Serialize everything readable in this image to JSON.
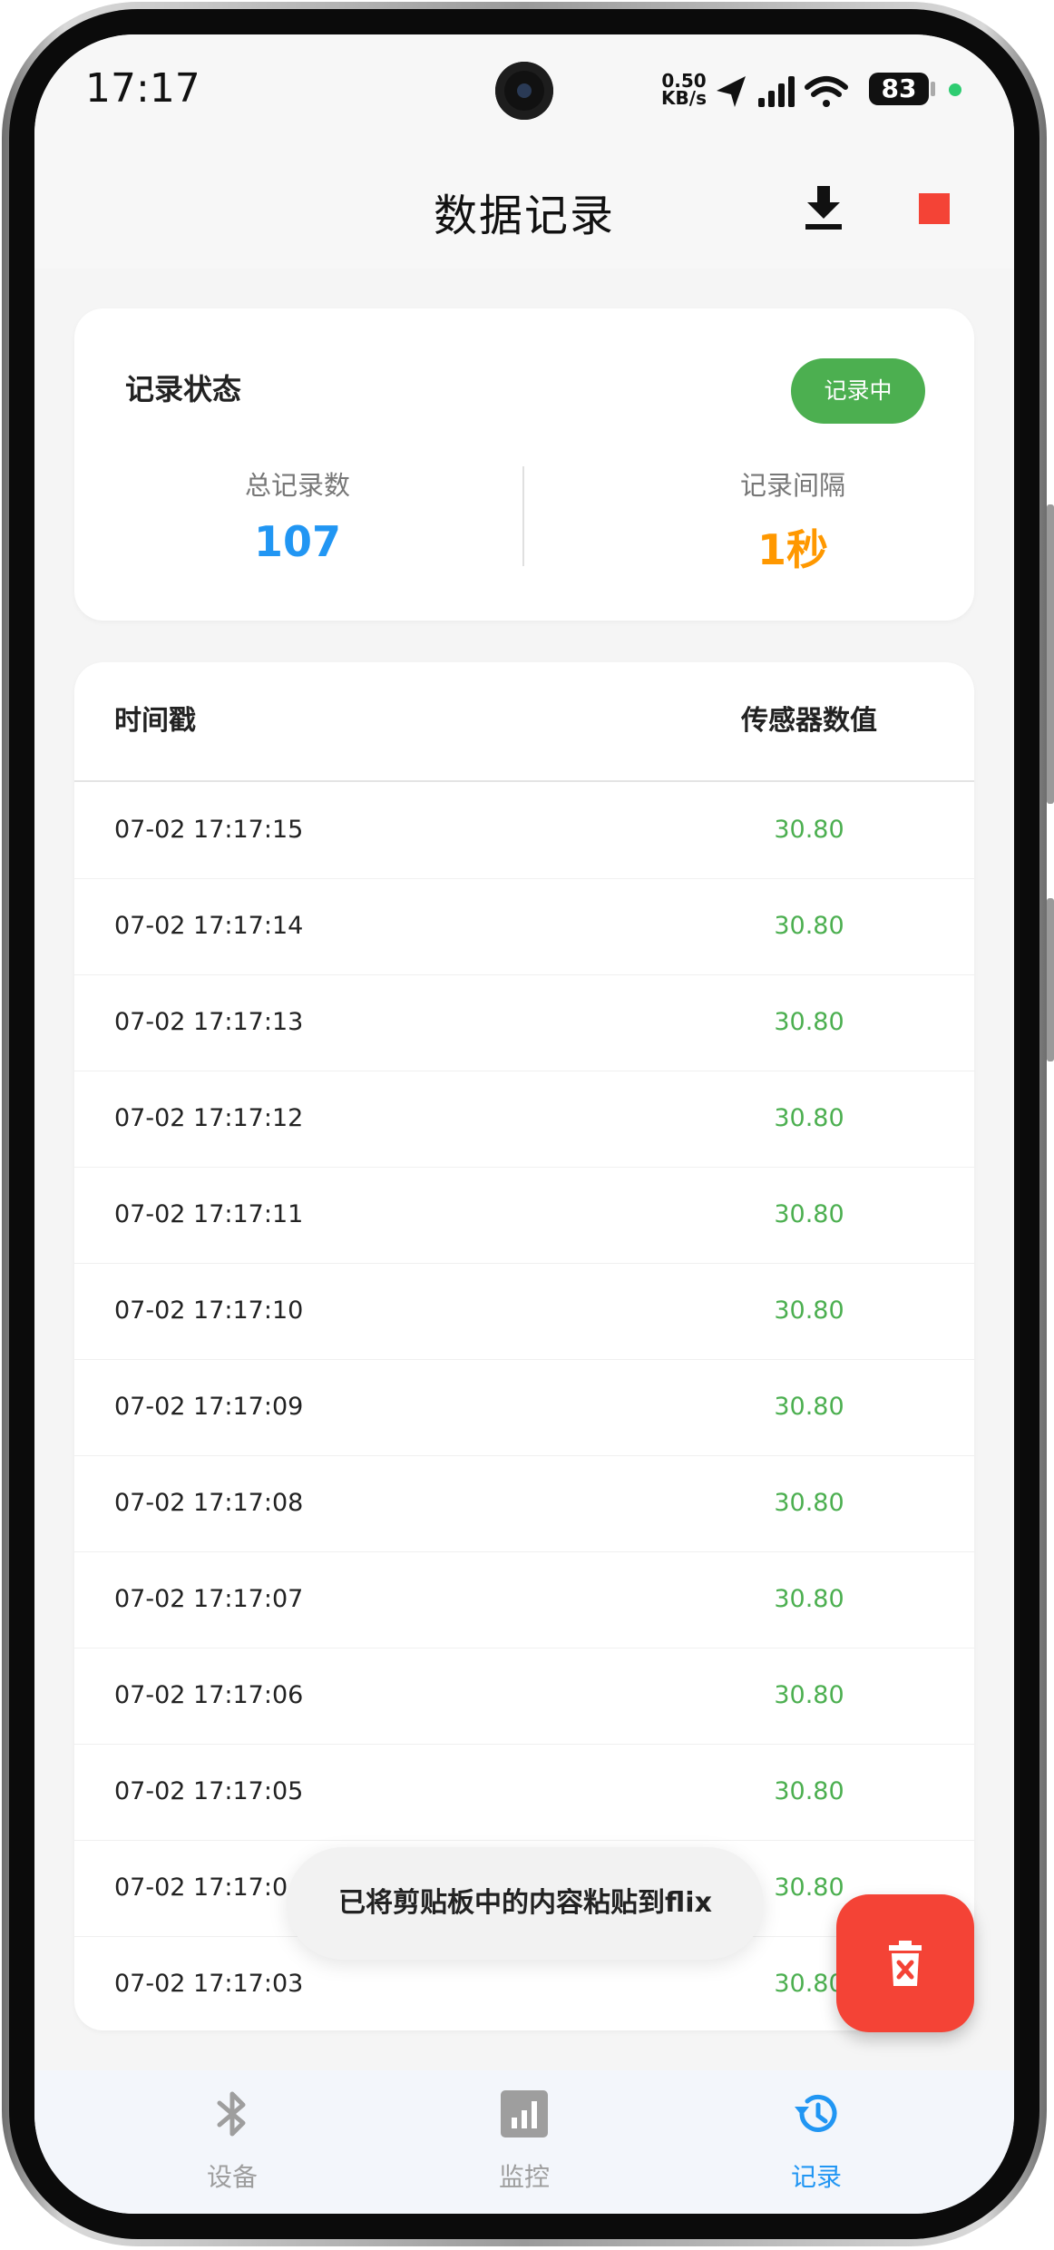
{
  "status_bar": {
    "time": "17:17",
    "net_speed_value": "0.50",
    "net_speed_unit": "KB/s",
    "battery": "83"
  },
  "header": {
    "title": "数据记录",
    "download_icon": "download-icon",
    "stop_icon": "stop-icon"
  },
  "status_card": {
    "title": "记录状态",
    "badge": "记录中",
    "total_label": "总记录数",
    "total_value": "107",
    "interval_label": "记录间隔",
    "interval_value": "1秒",
    "colors": {
      "total": "#2196f3",
      "interval": "#ff9800",
      "badge": "#4caf50"
    }
  },
  "table": {
    "col_time": "时间戳",
    "col_value": "传感器数值",
    "rows": [
      {
        "time": "07-02 17:17:15",
        "value": "30.80"
      },
      {
        "time": "07-02 17:17:14",
        "value": "30.80"
      },
      {
        "time": "07-02 17:17:13",
        "value": "30.80"
      },
      {
        "time": "07-02 17:17:12",
        "value": "30.80"
      },
      {
        "time": "07-02 17:17:11",
        "value": "30.80"
      },
      {
        "time": "07-02 17:17:10",
        "value": "30.80"
      },
      {
        "time": "07-02 17:17:09",
        "value": "30.80"
      },
      {
        "time": "07-02 17:17:08",
        "value": "30.80"
      },
      {
        "time": "07-02 17:17:07",
        "value": "30.80"
      },
      {
        "time": "07-02 17:17:06",
        "value": "30.80"
      },
      {
        "time": "07-02 17:17:05",
        "value": "30.80"
      },
      {
        "time": "07-02 17:17:04",
        "value": "30.80"
      },
      {
        "time": "07-02 17:17:03",
        "value": "30.80"
      }
    ]
  },
  "toast": "已将剪贴板中的内容粘贴到flix",
  "fab": {
    "icon": "delete-icon",
    "color": "#f44336"
  },
  "bottom_nav": {
    "items": [
      {
        "label": "设备",
        "icon": "bluetooth-icon",
        "active": false
      },
      {
        "label": "监控",
        "icon": "chart-icon",
        "active": false
      },
      {
        "label": "记录",
        "icon": "history-icon",
        "active": true
      }
    ],
    "active_color": "#2196f3",
    "inactive_color": "#9e9e9e"
  }
}
